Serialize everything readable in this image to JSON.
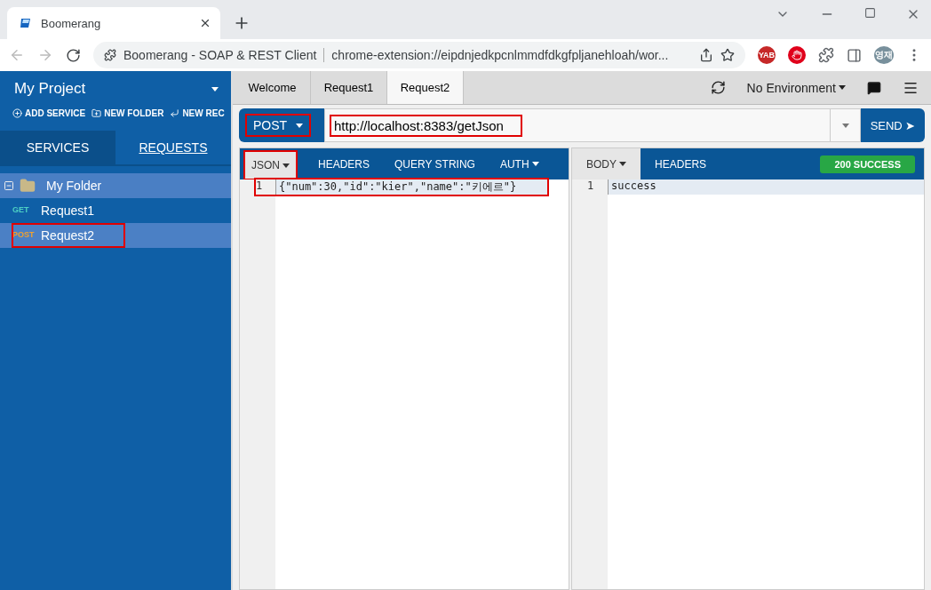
{
  "browser": {
    "tab_title": "Boomerang",
    "address_site": "Boomerang - SOAP & REST Client",
    "address_url": "chrome-extension://eipdnjedkpcnlmmdfdkgfpljanehloah/wor...",
    "extensions": [
      {
        "kind": "badge",
        "label": "YAB",
        "color": "#c62828"
      },
      {
        "kind": "stop",
        "color": "#e0001b"
      },
      {
        "kind": "puzzle"
      },
      {
        "kind": "sidepanel"
      },
      {
        "kind": "avatar",
        "label": "영재",
        "color": "#78909c"
      }
    ]
  },
  "sidebar": {
    "project": "My Project",
    "actions": [
      {
        "kind": "plus",
        "label": "ADD SERVICE"
      },
      {
        "kind": "folder",
        "label": "NEW FOLDER"
      },
      {
        "kind": "request",
        "label": "NEW REC"
      }
    ],
    "tabs": [
      {
        "label": "SERVICES",
        "selected": false
      },
      {
        "label": "REQUESTS",
        "selected": true
      }
    ],
    "tree": [
      {
        "name": "My Folder",
        "expanded": true,
        "children": [
          {
            "method": "GET",
            "name": "Request1",
            "color": "#4dd0c4",
            "selected": false,
            "highlighted": false
          },
          {
            "method": "POST",
            "name": "Request2",
            "color": "#f0a030",
            "selected": true,
            "highlighted": true
          }
        ]
      }
    ]
  },
  "top_tabs": [
    {
      "label": "Welcome",
      "selected": false
    },
    {
      "label": "Request1",
      "selected": false
    },
    {
      "label": "Request2",
      "selected": true
    }
  ],
  "environment": "No Environment",
  "request": {
    "method": "POST",
    "method_highlighted": true,
    "url": "http://localhost:8383/getJson",
    "url_highlighted": true,
    "send": "SEND ➤",
    "tabs": [
      {
        "label": "JSON",
        "dropdown": true,
        "selected": true,
        "highlighted": true
      },
      {
        "label": "HEADERS",
        "dropdown": false,
        "selected": false,
        "highlighted": false
      },
      {
        "label": "QUERY STRING",
        "dropdown": false,
        "selected": false,
        "highlighted": false
      },
      {
        "label": "AUTH",
        "dropdown": true,
        "selected": false,
        "highlighted": false
      }
    ],
    "lines": [
      {
        "number": "1",
        "text": "{\"num\":30,\"id\":\"kier\",\"name\":\"키에르\"}",
        "highlighted": true
      }
    ]
  },
  "response": {
    "tabs": [
      {
        "label": "BODY",
        "dropdown": true,
        "selected": true
      },
      {
        "label": "HEADERS",
        "dropdown": false,
        "selected": false
      }
    ],
    "status": "200 SUCCESS",
    "lines": [
      {
        "number": "1",
        "text": "success"
      }
    ]
  }
}
